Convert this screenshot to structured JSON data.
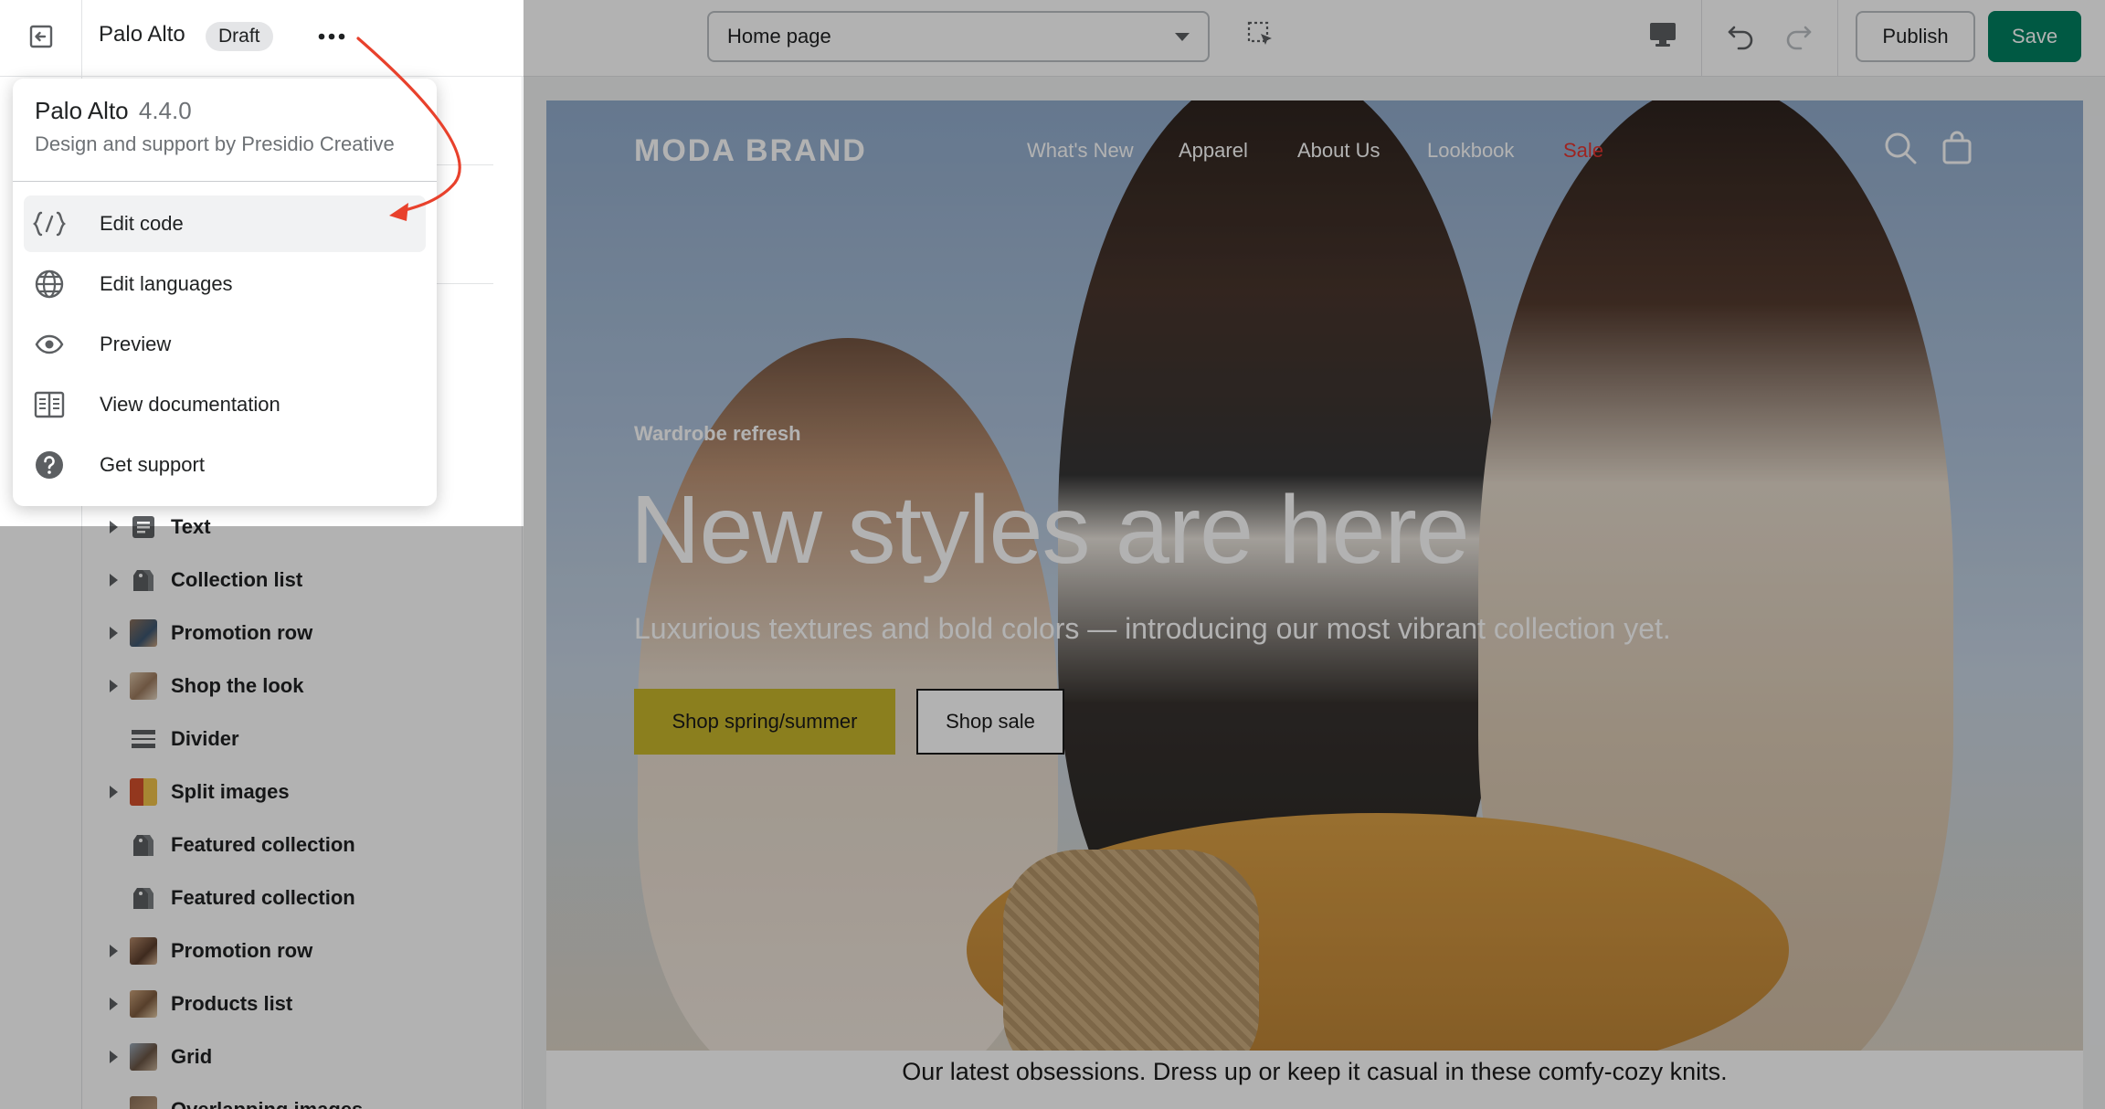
{
  "topbar": {
    "theme_name": "Palo Alto",
    "badge": "Draft",
    "page_select_value": "Home page",
    "publish_label": "Publish",
    "save_label": "Save"
  },
  "menu": {
    "title": "Palo Alto",
    "version": "4.4.0",
    "subtitle": "Design and support by Presidio Creative",
    "items": [
      {
        "label": "Edit code",
        "icon": "code-icon"
      },
      {
        "label": "Edit languages",
        "icon": "globe-icon"
      },
      {
        "label": "Preview",
        "icon": "eye-icon"
      },
      {
        "label": "View documentation",
        "icon": "book-icon"
      },
      {
        "label": "Get support",
        "icon": "question-icon"
      }
    ]
  },
  "sections": [
    {
      "label": "Text",
      "icon": "text-icon"
    },
    {
      "label": "Collection list",
      "icon": "tag-icon"
    },
    {
      "label": "Promotion row",
      "icon": "image-thumb"
    },
    {
      "label": "Shop the look",
      "icon": "image-thumb"
    },
    {
      "label": "Divider",
      "icon": "divider-icon"
    },
    {
      "label": "Split images",
      "icon": "image-thumb"
    },
    {
      "label": "Featured collection",
      "icon": "tag-icon"
    },
    {
      "label": "Featured collection",
      "icon": "tag-icon"
    },
    {
      "label": "Promotion row",
      "icon": "image-thumb"
    },
    {
      "label": "Products list",
      "icon": "image-thumb"
    },
    {
      "label": "Grid",
      "icon": "image-thumb"
    },
    {
      "label": "Overlapping images",
      "icon": "image-thumb"
    }
  ],
  "store": {
    "logo": "MODA BRAND",
    "nav": [
      "What's New",
      "Apparel",
      "About Us",
      "Lookbook",
      "Sale"
    ],
    "hero": {
      "kicker": "Wardrobe refresh",
      "title": "New styles are here",
      "subtitle": "Luxurious textures and bold colors — introducing our most vibrant collection yet.",
      "primary_button": "Shop spring/summer",
      "secondary_button": "Shop sale"
    },
    "tagline": "Our latest obsessions. Dress up or keep it casual in these comfy-cozy knits."
  },
  "colors": {
    "save_green": "#008060",
    "sale_red": "#e3342f",
    "hero_button": "#c8b62c",
    "annotation_arrow": "#e8412c"
  }
}
